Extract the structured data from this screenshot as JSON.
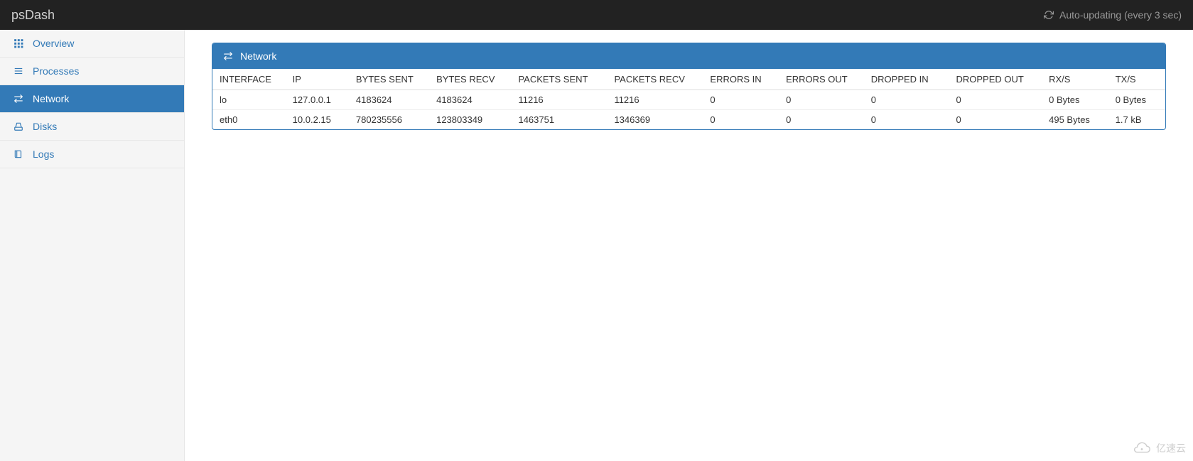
{
  "header": {
    "brand": "psDash",
    "auto_update_label": "Auto-updating (every 3 sec)"
  },
  "sidebar": {
    "items": [
      {
        "label": "Overview",
        "icon": "grid-icon",
        "active": false
      },
      {
        "label": "Processes",
        "icon": "list-icon",
        "active": false
      },
      {
        "label": "Network",
        "icon": "transfer-icon",
        "active": true
      },
      {
        "label": "Disks",
        "icon": "disk-icon",
        "active": false
      },
      {
        "label": "Logs",
        "icon": "book-icon",
        "active": false
      }
    ]
  },
  "panel": {
    "title": "Network",
    "columns": [
      "INTERFACE",
      "IP",
      "BYTES SENT",
      "BYTES RECV",
      "PACKETS SENT",
      "PACKETS RECV",
      "ERRORS IN",
      "ERRORS OUT",
      "DROPPED IN",
      "DROPPED OUT",
      "RX/S",
      "TX/S"
    ],
    "rows": [
      {
        "interface": "lo",
        "ip": "127.0.0.1",
        "bytes_sent": "4183624",
        "bytes_recv": "4183624",
        "packets_sent": "11216",
        "packets_recv": "11216",
        "errors_in": "0",
        "errors_out": "0",
        "dropped_in": "0",
        "dropped_out": "0",
        "rx_s": "0 Bytes",
        "tx_s": "0 Bytes"
      },
      {
        "interface": "eth0",
        "ip": "10.0.2.15",
        "bytes_sent": "780235556",
        "bytes_recv": "123803349",
        "packets_sent": "1463751",
        "packets_recv": "1346369",
        "errors_in": "0",
        "errors_out": "0",
        "dropped_in": "0",
        "dropped_out": "0",
        "rx_s": "495 Bytes",
        "tx_s": "1.7 kB"
      }
    ]
  },
  "watermark": {
    "text": "亿速云"
  }
}
